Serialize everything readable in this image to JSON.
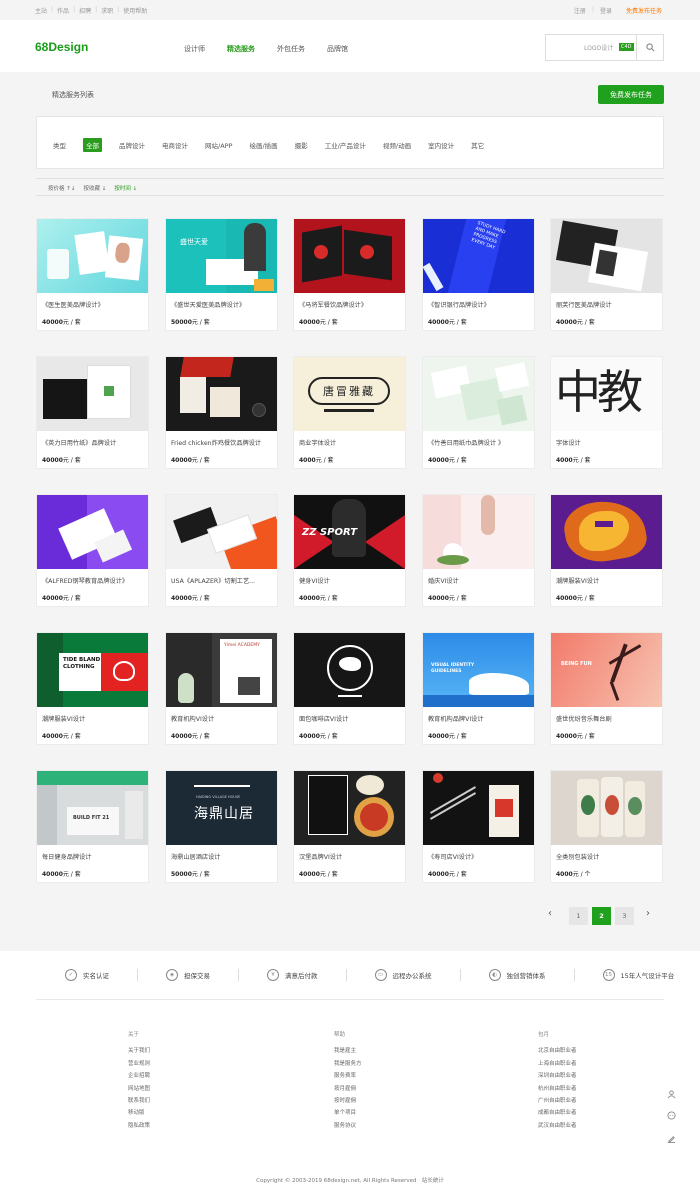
{
  "topbar": {
    "left": [
      "主站",
      "作品",
      "招聘",
      "求职",
      "使用帮助"
    ],
    "register": "注册",
    "login": "登录",
    "publish": "免费发布任务"
  },
  "header": {
    "logo": "68Design",
    "nav": [
      "设计师",
      "精选服务",
      "外包任务",
      "品牌馆"
    ],
    "active_nav": 1,
    "search_placeholder": "LOGO设计",
    "search_tag": "C4D"
  },
  "list": {
    "title": "精选服务列表",
    "free_button": "免费发布任务"
  },
  "filter": {
    "label": "类型",
    "options": [
      "全部",
      "品牌设计",
      "电商设计",
      "网站/APP",
      "绘画/插画",
      "摄影",
      "工业/产品设计",
      "视频/动画",
      "室内设计",
      "其它"
    ],
    "active": 0
  },
  "sort": {
    "options": [
      "按价格 ↑↓",
      "按收藏 ↓",
      "按时间 ↓"
    ],
    "active": 2
  },
  "cards": [
    {
      "title": "《医生医美品牌设计》",
      "price": "40000",
      "unit": "元 / 套"
    },
    {
      "title": "《盛世天爱医美品牌设计》",
      "price": "50000",
      "unit": "元 / 套"
    },
    {
      "title": "《马将军餐饮品牌设计》",
      "price": "40000",
      "unit": "元 / 套"
    },
    {
      "title": "《智识银行品牌设计》",
      "price": "40000",
      "unit": "元 / 套"
    },
    {
      "title": "丽芙行医美品牌设计",
      "price": "40000",
      "unit": "元 / 套"
    },
    {
      "title": "《英力日用竹纸》品牌设计",
      "price": "40000",
      "unit": "元 / 套"
    },
    {
      "title": "Fried chicken炸鸡餐饮品牌设计",
      "price": "40000",
      "unit": "元 / 套"
    },
    {
      "title": "商业字体设计",
      "price": "4000",
      "unit": "元 / 套"
    },
    {
      "title": "《竹善日用纸巾品牌设计 》",
      "price": "40000",
      "unit": "元 / 套"
    },
    {
      "title": "字体设计",
      "price": "4000",
      "unit": "元 / 套"
    },
    {
      "title": "《ALFRED钢琴教育品牌设计》",
      "price": "40000",
      "unit": "元 / 套"
    },
    {
      "title": "USA《APLAZER》切割工艺...",
      "price": "40000",
      "unit": "元 / 套"
    },
    {
      "title": "健身VI设计",
      "price": "40000",
      "unit": "元 / 套"
    },
    {
      "title": "婚庆VI设计",
      "price": "40000",
      "unit": "元 / 套"
    },
    {
      "title": "潮牌服装VI设计",
      "price": "40000",
      "unit": "元 / 套"
    },
    {
      "title": "潮牌服装VI设计",
      "price": "40000",
      "unit": "元 / 套"
    },
    {
      "title": "教育机构VI设计",
      "price": "40000",
      "unit": "元 / 套"
    },
    {
      "title": "面包咖啡店VI设计",
      "price": "40000",
      "unit": "元 / 套"
    },
    {
      "title": "教育机构品牌VI设计",
      "price": "40000",
      "unit": "元 / 套"
    },
    {
      "title": "盛世优纷音乐舞台剧",
      "price": "40000",
      "unit": "元 / 套"
    },
    {
      "title": "每日健身品牌设计",
      "price": "40000",
      "unit": "元 / 套"
    },
    {
      "title": "海鼎山居酒店设计",
      "price": "50000",
      "unit": "元 / 套"
    },
    {
      "title": "汉堡品牌VI设计",
      "price": "40000",
      "unit": "元 / 套"
    },
    {
      "title": "《寿司店VI设计》",
      "price": "40000",
      "unit": "元 / 套"
    },
    {
      "title": "全类别包装设计",
      "price": "4000",
      "unit": "元 / 个"
    }
  ],
  "thumb_text": {
    "c2": "盛世天爱",
    "c4": "STUDY HARD AND MAKE PROGRESS EVERY DAY",
    "c8": "唐冒雅藏",
    "c10": "中教",
    "c13": "ZZ SPORT",
    "c16": "TIDE BLAND CLOTHING",
    "c17": "Yimei ACADEMY",
    "c19": "VISUAL IDENTITY GUIDELINES",
    "c20": "BEING FUN",
    "c21": "BUILD FIT 21",
    "c22": "海鼎山居",
    "c22sub": "HAIDING VILLAGE HOUSE"
  },
  "pager": {
    "pages": [
      "1",
      "2",
      "3"
    ],
    "active": 1
  },
  "footer": {
    "features": [
      "实名认证",
      "担保交易",
      "满意后付款",
      "远程办公系统",
      "独创营销体系",
      "15年人气设计平台"
    ],
    "feature_icons": [
      "user-check-icon",
      "shield-icon",
      "money-icon",
      "remote-office-icon",
      "marketing-icon",
      "fifteen-icon"
    ],
    "col1": {
      "head": "关于",
      "items": [
        "关于我们",
        "营业规则",
        "企业招聘",
        "网站地图",
        "联系我们",
        "移动版",
        "隐私政策"
      ]
    },
    "col2": {
      "head": "帮助",
      "items": [
        "我是雇主",
        "我是服务方",
        "服务费率",
        "按月雇佣",
        "按时雇佣",
        "单个项目",
        "服务协议"
      ]
    },
    "col3": {
      "head": "包月",
      "items": [
        "北京自由职业者",
        "上海自由职业者",
        "深圳自由职业者",
        "杭州自由职业者",
        "广州自由职业者",
        "成都自由职业者",
        "武汉自由职业者"
      ]
    },
    "copyright": "Copyright © 2003-2019 68design.net, All Rights Reserved",
    "stats": "站长统计"
  },
  "colors": {
    "brand": "#2a9d1e",
    "accent_orange": "#ff7a00"
  }
}
